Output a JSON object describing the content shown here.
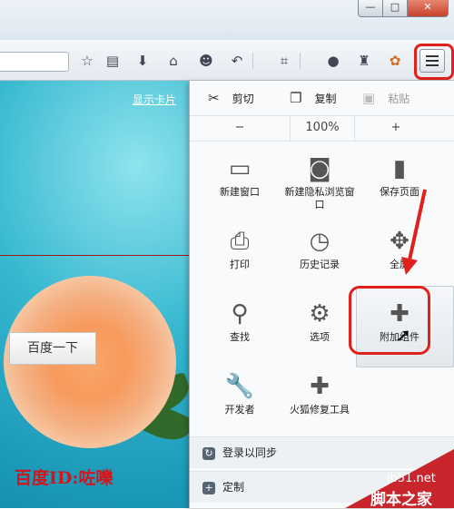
{
  "window": {
    "controls": {
      "min": "—",
      "max": "□",
      "close": "✕"
    }
  },
  "toolbar": {
    "url_text": "",
    "buttons": [
      {
        "icon": "star-icon",
        "glyph": "☆"
      },
      {
        "icon": "reading-list-icon",
        "glyph": "▤"
      },
      {
        "icon": "download-icon",
        "glyph": "⬇"
      },
      {
        "icon": "home-icon",
        "glyph": "⌂"
      },
      {
        "icon": "chat-icon",
        "glyph": "☻"
      },
      {
        "icon": "undo-icon",
        "glyph": "↶"
      },
      {
        "icon": "crop-icon",
        "glyph": "⌗"
      },
      {
        "icon": "comment-icon",
        "glyph": "●"
      },
      {
        "icon": "addon-icon",
        "glyph": "♜"
      },
      {
        "icon": "theme-icon",
        "glyph": "✿"
      }
    ]
  },
  "page": {
    "show_card": "显示卡片",
    "search_button": "百度一下",
    "watermark_id": "百度ID:咗嚛"
  },
  "menu": {
    "edit": {
      "cut": "剪切",
      "copy": "复制",
      "paste": "粘贴"
    },
    "zoom": {
      "minus": "−",
      "level": "100%",
      "plus": "+"
    },
    "items": [
      {
        "label": "新建窗口",
        "icon": "window-icon",
        "glyph": "▭"
      },
      {
        "label": "新建隐私浏览窗口",
        "icon": "mask-icon",
        "glyph": "◙"
      },
      {
        "label": "保存页面",
        "icon": "save-page-icon",
        "glyph": "▮"
      },
      {
        "label": "打印",
        "icon": "printer-icon",
        "glyph": "⎙"
      },
      {
        "label": "历史记录",
        "icon": "history-icon",
        "glyph": "◷"
      },
      {
        "label": "全屏",
        "icon": "fullscreen-icon",
        "glyph": "✥"
      },
      {
        "label": "查找",
        "icon": "search-icon",
        "glyph": "⚲"
      },
      {
        "label": "选项",
        "icon": "gear-icon",
        "glyph": "⚙"
      },
      {
        "label": "附加组件",
        "icon": "puzzle-icon",
        "glyph": "✚"
      },
      {
        "label": "开发者",
        "icon": "wrench-icon",
        "glyph": "🔧"
      },
      {
        "label": "火狐修复工具",
        "icon": "firstaid-icon",
        "glyph": "✚"
      }
    ],
    "sign_in": "登录以同步",
    "customize": "定制"
  },
  "watermark": {
    "site": "jb51.net",
    "name": "脚本之家"
  },
  "colors": {
    "highlight": "#e0201c",
    "page_accent": "#1a96b6"
  }
}
